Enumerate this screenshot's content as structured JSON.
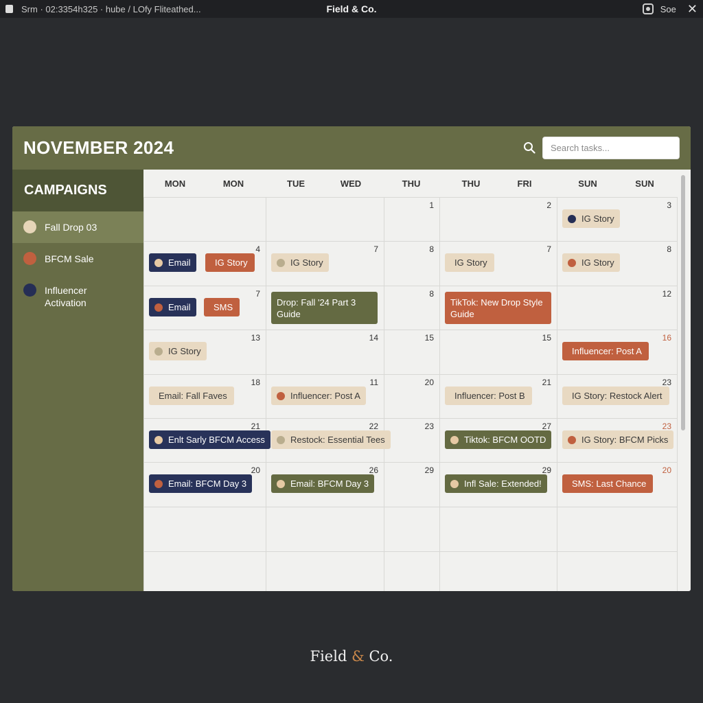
{
  "topbar": {
    "status": "Srm · 02:3354h325 · hube / LOfy Fliteathed...",
    "title": "Field & Co.",
    "right_label": "Soe",
    "close": "✕"
  },
  "header": {
    "title": "NOVEMBER 2024",
    "search_placeholder": "Search tasks..."
  },
  "sidebar": {
    "title": "CAMPAIGNS",
    "items": [
      {
        "label": "Fall Drop 03",
        "color": "#e6d5b8",
        "active": true
      },
      {
        "label": "BFCM Sale",
        "color": "#c0603f",
        "active": false
      },
      {
        "label": "Influencer Activation",
        "color": "#252e55",
        "active": false
      }
    ]
  },
  "colors": {
    "navy": "#283259",
    "terracotta": "#c0603f",
    "beige": "#e8d9c2",
    "olive": "#646a42",
    "dot_beige": "#e6c9a4",
    "dot_terracotta": "#c0603f",
    "dot_navy": "#252e55",
    "dot_tan": "#b9ad8e"
  },
  "calendar": {
    "days_of_week": [
      "MON",
      "MON",
      "TUE",
      "WED",
      "THU",
      "THU",
      "FRI",
      "SUN",
      "SUN"
    ],
    "rows": [
      {
        "nums": [
          "",
          "",
          "1",
          "2",
          "3"
        ],
        "hl": []
      },
      {
        "nums": [
          "4",
          "7",
          "8",
          "7",
          "8"
        ],
        "hl": []
      },
      {
        "nums": [
          "7",
          "",
          "8",
          "",
          "12"
        ],
        "hl": []
      },
      {
        "nums": [
          "13",
          "14",
          "15",
          "15",
          "16"
        ],
        "hl": [
          4
        ]
      },
      {
        "nums": [
          "18",
          "11",
          "20",
          "21",
          "23"
        ],
        "hl": []
      },
      {
        "nums": [
          "21",
          "22",
          "23",
          "27",
          "23"
        ],
        "hl": [
          4
        ]
      },
      {
        "nums": [
          "20",
          "26",
          "29",
          "29",
          "20"
        ],
        "hl": [
          4
        ]
      }
    ],
    "events": [
      {
        "row": 0,
        "col": 4,
        "label": "IG Story",
        "style": "beige",
        "dot": "dot_navy"
      },
      {
        "row": 1,
        "col": 0,
        "label": "Email",
        "style": "navy",
        "dot": "dot_beige"
      },
      {
        "row": 1,
        "col": 0,
        "label": "IG Story",
        "style": "terracotta",
        "dot": "",
        "offset": 1
      },
      {
        "row": 1,
        "col": 1,
        "label": "IG Story",
        "style": "beige",
        "dot": "dot_tan"
      },
      {
        "row": 1,
        "col": 3,
        "label": "IG Story",
        "style": "beige",
        "dot": ""
      },
      {
        "row": 1,
        "col": 4,
        "label": "IG Story",
        "style": "beige",
        "dot": "dot_terracotta"
      },
      {
        "row": 2,
        "col": 0,
        "label": "Email",
        "style": "navy",
        "dot": "dot_terracotta"
      },
      {
        "row": 2,
        "col": 0,
        "label": "SMS",
        "style": "terracotta",
        "dot": "",
        "offset": 1
      },
      {
        "row": 2,
        "col": 1,
        "label": "Drop: Fall '24 Part 3 Guide",
        "style": "olive",
        "dot": "",
        "tall": true
      },
      {
        "row": 2,
        "col": 3,
        "label": "TikTok: New Drop Style Guide",
        "style": "terracotta",
        "dot": "",
        "tall": true
      },
      {
        "row": 3,
        "col": 0,
        "label": "IG Story",
        "style": "beige",
        "dot": "dot_tan"
      },
      {
        "row": 3,
        "col": 4,
        "label": "Influencer: Post A",
        "style": "terracotta",
        "dot": ""
      },
      {
        "row": 4,
        "col": 0,
        "label": "Email: Fall Faves",
        "style": "beige",
        "dot": ""
      },
      {
        "row": 4,
        "col": 1,
        "label": "Influencer: Post A",
        "style": "beige",
        "dot": "dot_terracotta"
      },
      {
        "row": 4,
        "col": 3,
        "label": "Influencer: Post B",
        "style": "beige",
        "dot": ""
      },
      {
        "row": 4,
        "col": 4,
        "label": "IG Story: Restock Alert",
        "style": "beige",
        "dot": ""
      },
      {
        "row": 5,
        "col": 0,
        "label": "Enlt Sarly BFCM Access",
        "style": "navy",
        "dot": "dot_beige"
      },
      {
        "row": 5,
        "col": 1,
        "label": "Restock: Essential Tees",
        "style": "beige",
        "dot": "dot_tan"
      },
      {
        "row": 5,
        "col": 3,
        "label": "Tiktok: BFCM OOTD",
        "style": "olive",
        "dot": "dot_beige"
      },
      {
        "row": 5,
        "col": 4,
        "label": "IG Story: BFCM Picks",
        "style": "beige",
        "dot": "dot_terracotta"
      },
      {
        "row": 6,
        "col": 0,
        "label": "Email: BFCM Day 3",
        "style": "navy",
        "dot": "dot_terracotta"
      },
      {
        "row": 6,
        "col": 1,
        "label": "Email: BFCM Day 3",
        "style": "olive",
        "dot": "dot_beige"
      },
      {
        "row": 6,
        "col": 3,
        "label": "Infl Sale: Extended!",
        "style": "olive",
        "dot": "dot_beige"
      },
      {
        "row": 6,
        "col": 4,
        "label": "SMS: Last Chance",
        "style": "terracotta",
        "dot": ""
      }
    ]
  },
  "brand": {
    "pre": "Field ",
    "amp": "&",
    "post": " Co."
  }
}
